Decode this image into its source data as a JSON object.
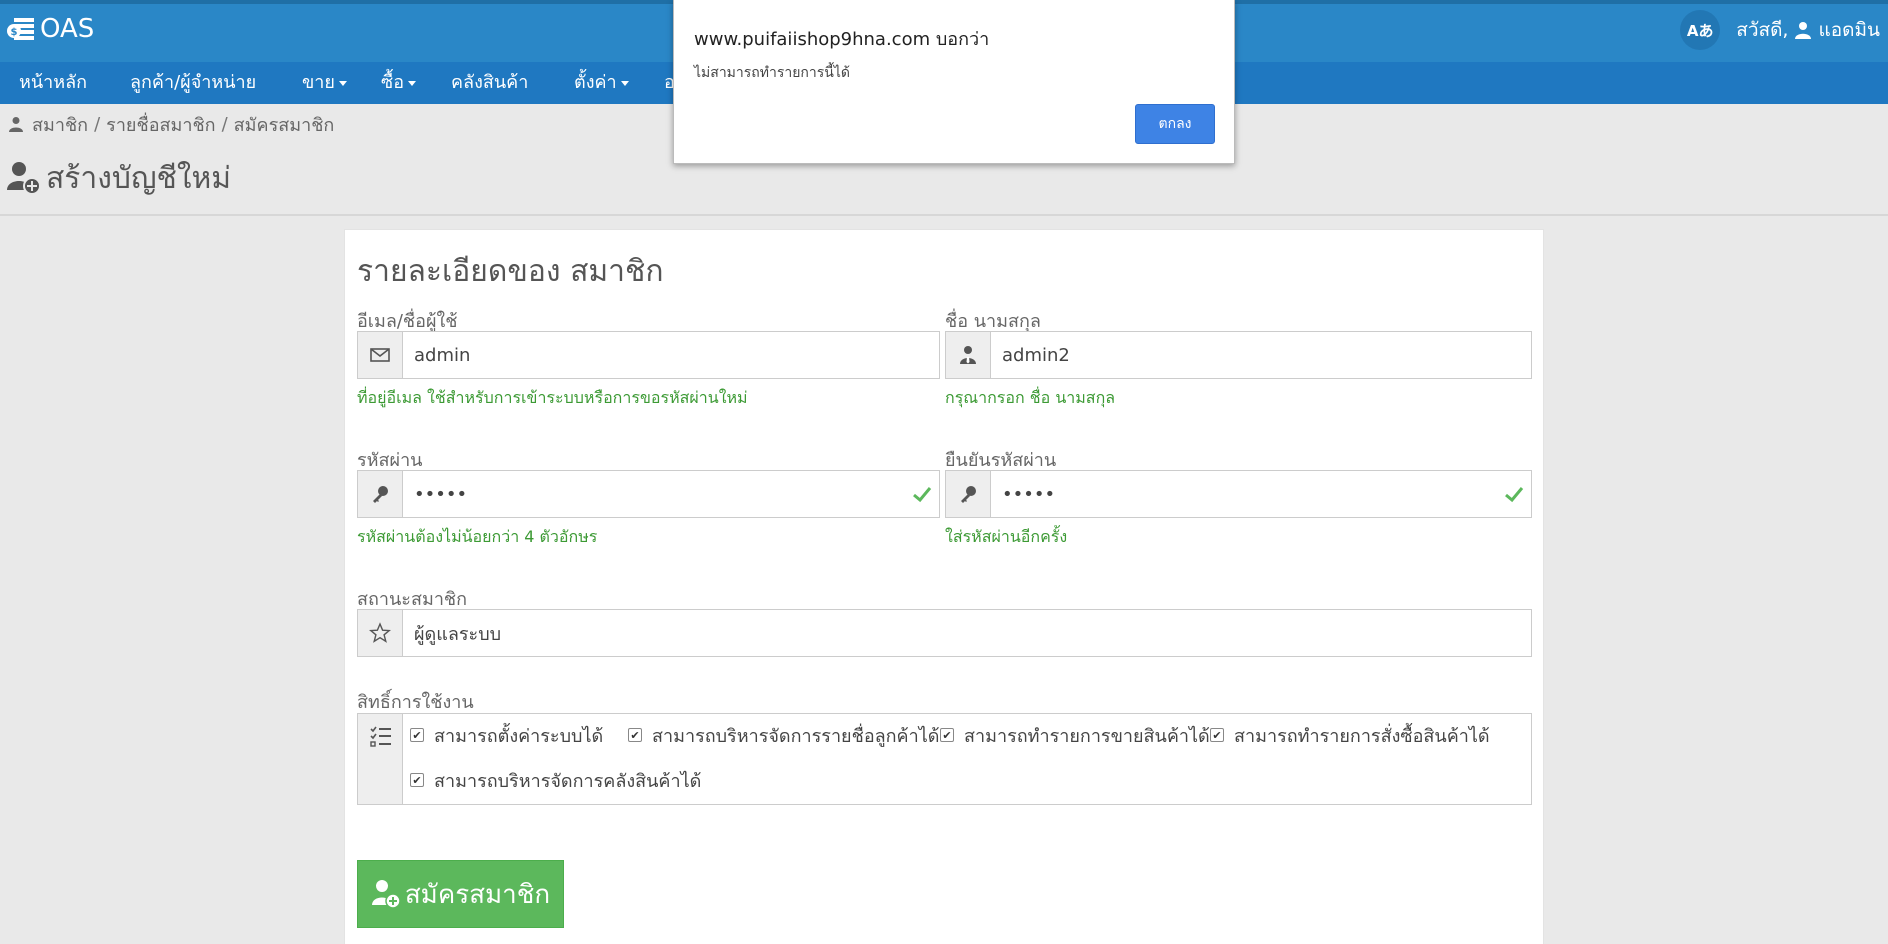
{
  "app": {
    "brand": "OAS",
    "language_button": "Aあ",
    "greeting": "สวัสดี,",
    "user_name": "แอดมิน"
  },
  "nav": {
    "items": [
      {
        "label": "หน้าหลัก",
        "dropdown": false
      },
      {
        "label": "ลูกค้า/ผู้จำหน่าย",
        "dropdown": false
      },
      {
        "label": "ขาย",
        "dropdown": true
      },
      {
        "label": "ซื้อ",
        "dropdown": true
      },
      {
        "label": "คลังสินค้า",
        "dropdown": false
      },
      {
        "label": "ตั้งค่า",
        "dropdown": true
      },
      {
        "label": "อ",
        "dropdown": false
      }
    ]
  },
  "breadcrumb": [
    "สมาชิก",
    "รายชื่อสมาชิก",
    "สมัครสมาชิก"
  ],
  "page_title": "สร้างบัญชีใหม่",
  "form": {
    "section_title": "รายละเอียดของ สมาชิก",
    "email": {
      "label": "อีเมล/ชื่อผู้ใช้",
      "value": "admin",
      "help": "ที่อยู่อีเมล ใช้สำหรับการเข้าระบบหรือการขอรหัสผ่านใหม่"
    },
    "name": {
      "label": "ชื่อ นามสกุล",
      "value": "admin2",
      "help": "กรุณากรอก ชื่อ นามสกุล"
    },
    "password": {
      "label": "รหัสผ่าน",
      "value": "admin",
      "help": "รหัสผ่านต้องไม่น้อยกว่า 4 ตัวอักษร"
    },
    "confirm_password": {
      "label": "ยืนยันรหัสผ่าน",
      "value": "admin",
      "help": "ใส่รหัสผ่านอีกครั้ง"
    },
    "status": {
      "label": "สถานะสมาชิก",
      "value": "ผู้ดูแลระบบ"
    },
    "permissions": {
      "label": "สิทธิ์การใช้งาน",
      "items": [
        {
          "label": "สามารถตั้งค่าระบบได้",
          "checked": true
        },
        {
          "label": "สามารถบริหารจัดการรายชื่อลูกค้าได้",
          "checked": true
        },
        {
          "label": "สามารถทำรายการขายสินค้าได้",
          "checked": true
        },
        {
          "label": "สามารถทำรายการสั่งซื้อสินค้าได้",
          "checked": true
        },
        {
          "label": "สามารถบริหารจัดการคลังสินค้าได้",
          "checked": true
        }
      ]
    },
    "submit_label": "สมัครสมาชิก"
  },
  "dialog": {
    "title": "www.puifaiishop9hna.com บอกว่า",
    "message": "ไม่สามารถทำรายการนี้ได้",
    "ok_label": "ตกลง"
  },
  "colors": {
    "topbar": "#2a87c7",
    "navbar": "#1f78c1",
    "help_text": "#3c9a34",
    "submit": "#5cb85c",
    "dialog_ok": "#3e83e5"
  }
}
